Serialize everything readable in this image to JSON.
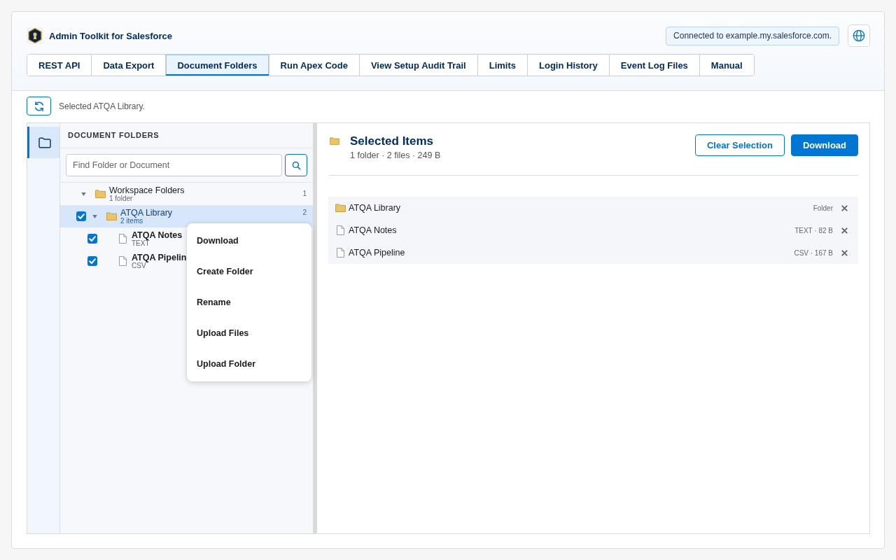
{
  "app": {
    "title": "Admin Toolkit for Salesforce",
    "connection": "Connected to example.my.salesforce.com."
  },
  "tabs": [
    {
      "label": "REST API",
      "selected": false
    },
    {
      "label": "Data Export",
      "selected": false
    },
    {
      "label": "Document Folders",
      "selected": true
    },
    {
      "label": "Run Apex Code",
      "selected": false
    },
    {
      "label": "View Setup Audit Trail",
      "selected": false
    },
    {
      "label": "Limits",
      "selected": false
    },
    {
      "label": "Login History",
      "selected": false
    },
    {
      "label": "Event Log Files",
      "selected": false
    },
    {
      "label": "Manual",
      "selected": false
    }
  ],
  "toolbar": {
    "status": "Selected ATQA Library."
  },
  "rail": {
    "items": [
      {
        "kind": "folders",
        "selected": true
      }
    ]
  },
  "tree": {
    "title": "DOCUMENT FOLDERS",
    "search": {
      "placeholder": "Find Folder or Document"
    },
    "nodes": [
      {
        "kind": "root",
        "name": "Workspace Folders",
        "detail": "1 folder",
        "count": "1",
        "expanded": true,
        "selected": false,
        "children": [
          {
            "kind": "folder",
            "name": "ATQA Library",
            "detail": "2 items",
            "count": "2",
            "checked": true,
            "expanded": true,
            "selected": true,
            "children": [
              {
                "kind": "file",
                "name": "ATQA Notes",
                "detail": "TEXT",
                "checked": true,
                "selected": false
              },
              {
                "kind": "file",
                "name": "ATQA Pipelin",
                "detail": "CSV",
                "checked": true,
                "selected": false
              }
            ]
          }
        ]
      }
    ]
  },
  "context_menu": {
    "items": [
      "Download",
      "Create Folder",
      "Rename",
      "Upload Files",
      "Upload Folder"
    ]
  },
  "selection": {
    "title": "Selected Items",
    "summary": "1 folder · 2 files · 249 B",
    "buttons": [
      {
        "label": "Clear Selection",
        "kind": "secondary"
      },
      {
        "label": "Download",
        "kind": "primary"
      }
    ],
    "items": [
      {
        "kind": "folder",
        "name": "ATQA Library",
        "meta": "Folder"
      },
      {
        "kind": "file",
        "name": "ATQA Notes",
        "meta": "TEXT · 82 B"
      },
      {
        "kind": "file",
        "name": "ATQA Pipeline",
        "meta": "CSV · 167 B"
      }
    ]
  }
}
